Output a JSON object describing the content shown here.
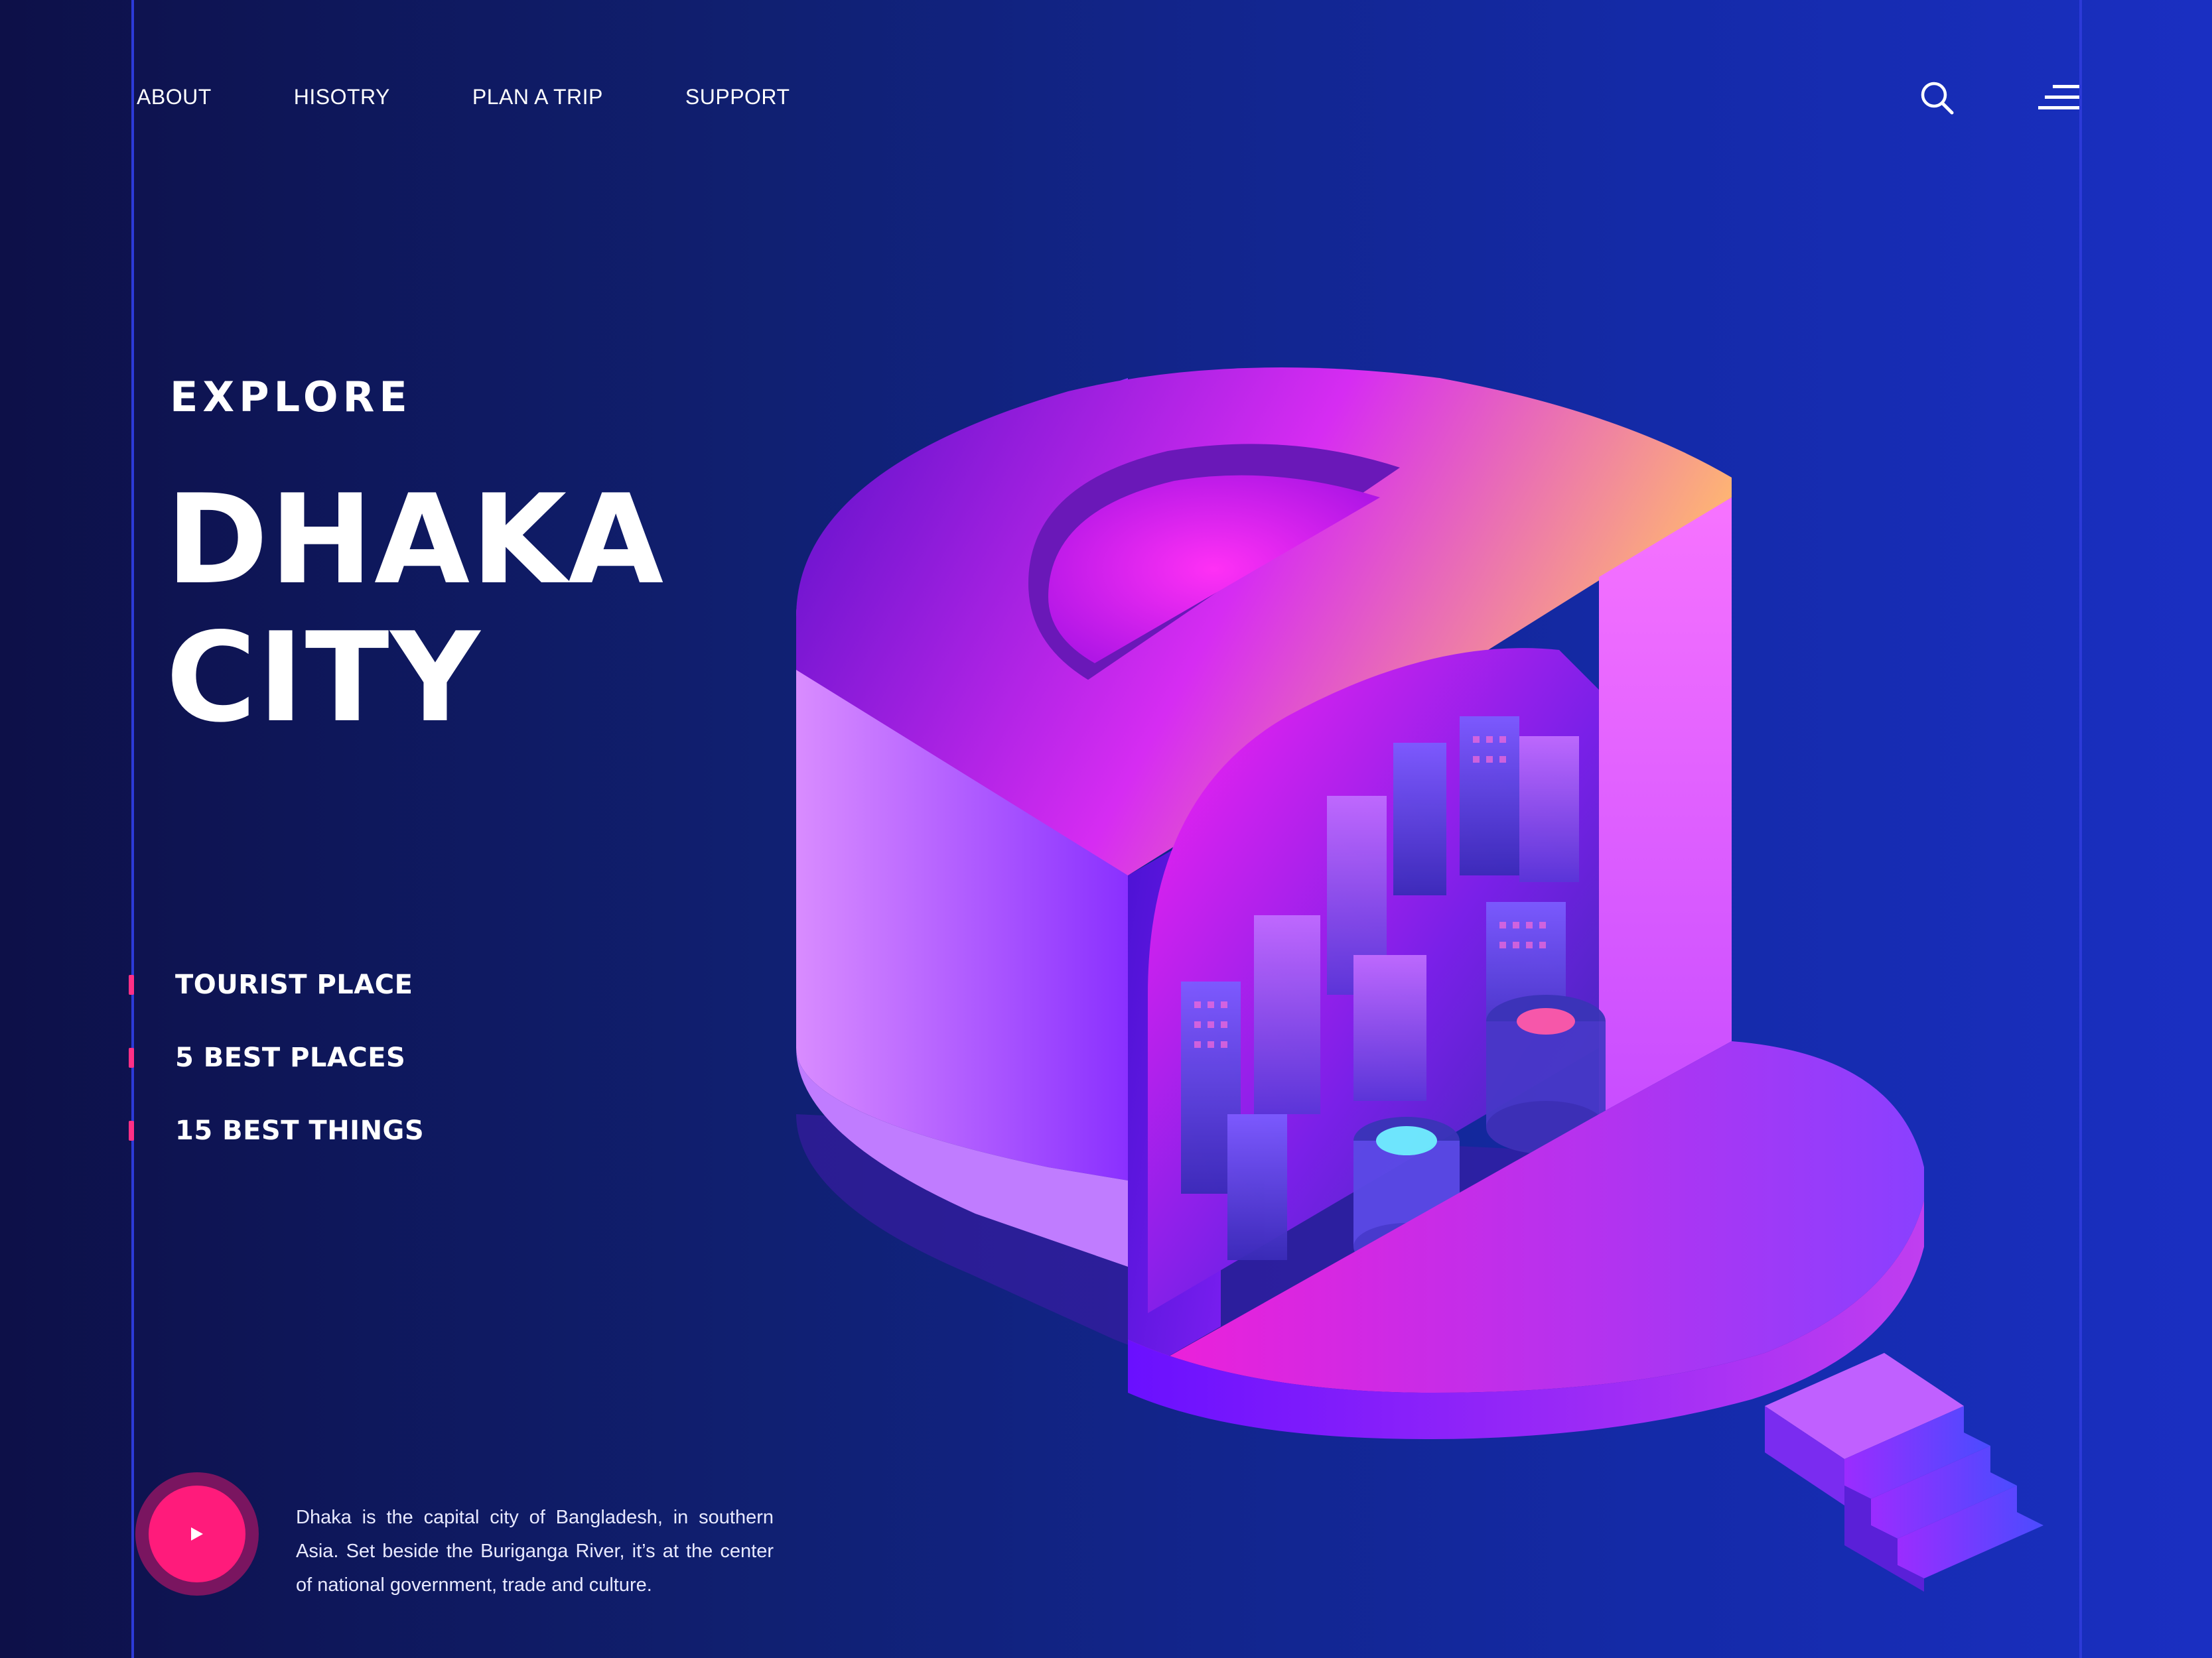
{
  "nav": {
    "items": [
      {
        "label": "ABOUT"
      },
      {
        "label": "HISOTRY"
      },
      {
        "label": "PLAN A TRIP"
      },
      {
        "label": "SUPPORT"
      }
    ],
    "search_icon": "search-icon",
    "menu_icon": "menu-icon"
  },
  "hero": {
    "eyebrow": "EXPLORE",
    "title_line1": "DHAKA",
    "title_line2": "CITY"
  },
  "features": [
    {
      "label": "TOURIST PLACE"
    },
    {
      "label": "5 BEST PLACES"
    },
    {
      "label": "15 BEST THINGS"
    }
  ],
  "play": {
    "icon": "play-icon"
  },
  "description": "Dhaka is the capital city of Bangladesh, in southern Asia. Set beside the Buriganga River, it’s at the center of national government, trade and culture.",
  "colors": {
    "background_start": "#0d1048",
    "background_end": "#1a2fc2",
    "accent_pink": "#ff1b7b",
    "accent_purple": "#9b2cff",
    "guide_line": "#2c3ad8"
  }
}
